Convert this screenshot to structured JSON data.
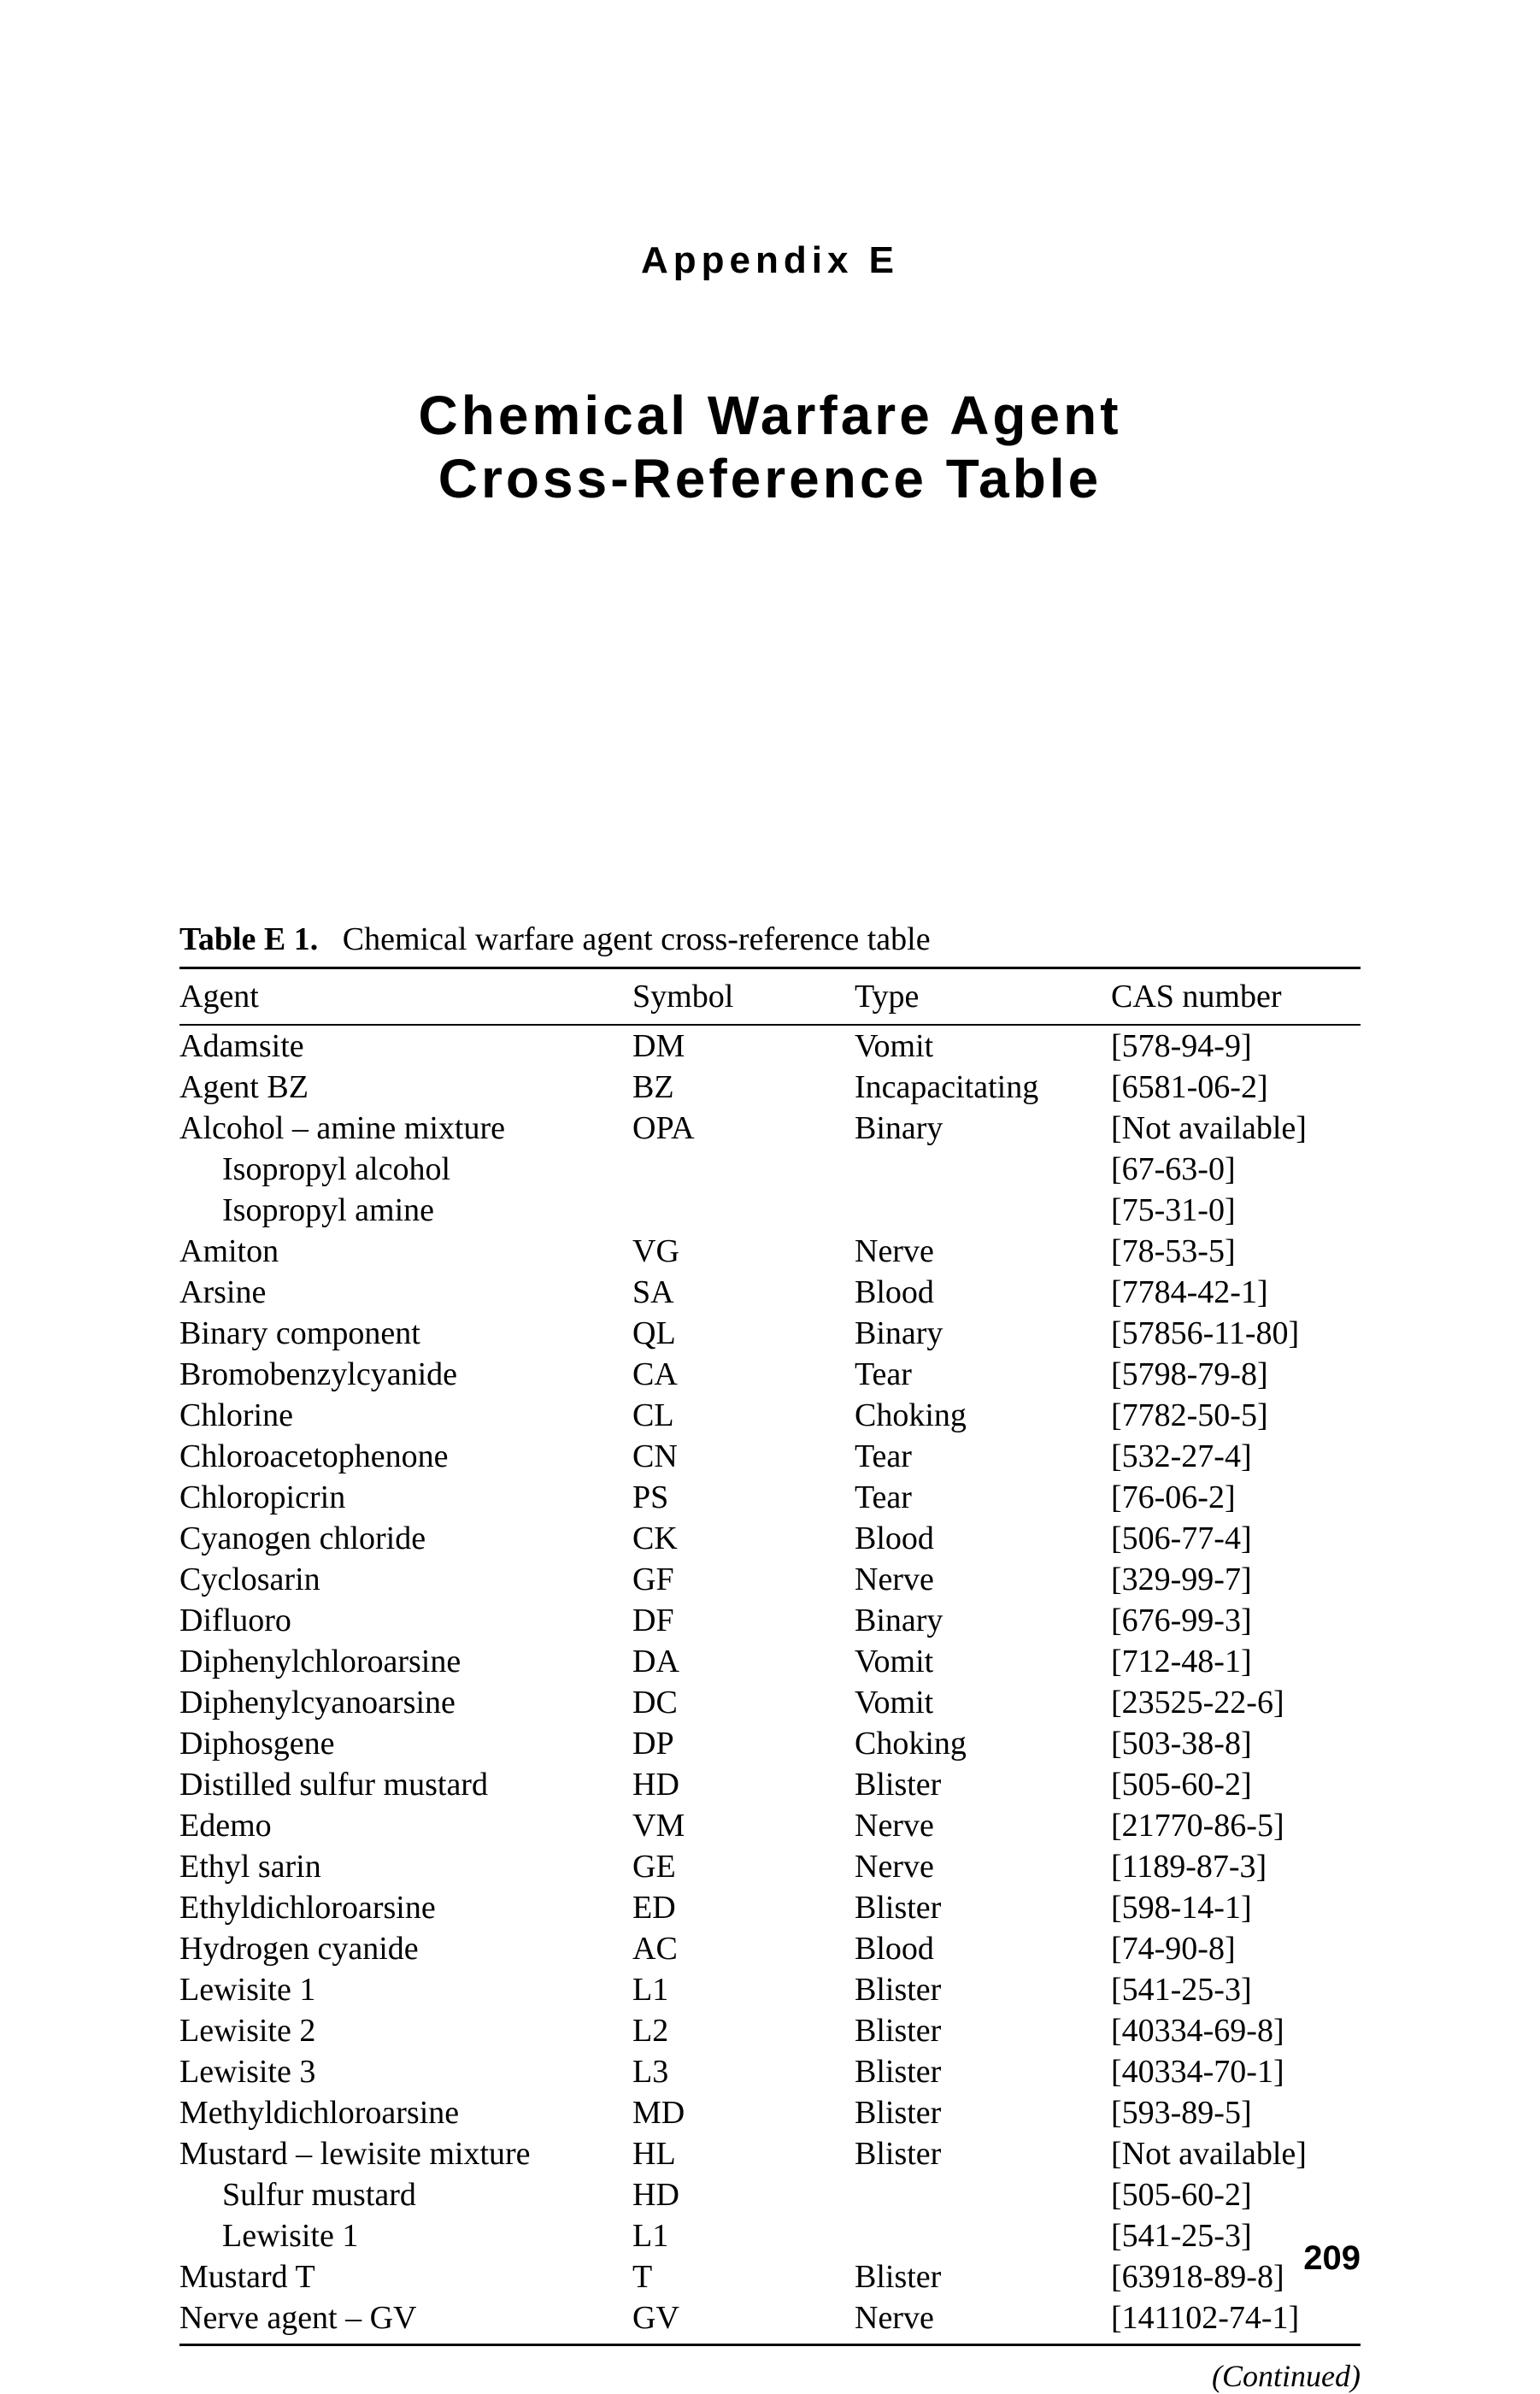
{
  "appendix_label": "Appendix E",
  "title_line1": "Chemical Warfare Agent",
  "title_line2": "Cross-Reference Table",
  "caption_bold": "Table E 1.",
  "caption_rest": "Chemical warfare agent cross-reference table",
  "headers": {
    "agent": "Agent",
    "symbol": "Symbol",
    "type": "Type",
    "cas": "CAS number"
  },
  "rows": [
    {
      "agent": "Adamsite",
      "symbol": "DM",
      "type": "Vomit",
      "cas": "[578-94-9]",
      "indent": false
    },
    {
      "agent": "Agent BZ",
      "symbol": "BZ",
      "type": "Incapacitating",
      "cas": "[6581-06-2]",
      "indent": false
    },
    {
      "agent": "Alcohol – amine mixture",
      "symbol": "OPA",
      "type": "Binary",
      "cas": "[Not available]",
      "indent": false
    },
    {
      "agent": "Isopropyl alcohol",
      "symbol": "",
      "type": "",
      "cas": "[67-63-0]",
      "indent": true
    },
    {
      "agent": "Isopropyl amine",
      "symbol": "",
      "type": "",
      "cas": "[75-31-0]",
      "indent": true
    },
    {
      "agent": "Amiton",
      "symbol": "VG",
      "type": "Nerve",
      "cas": "[78-53-5]",
      "indent": false
    },
    {
      "agent": "Arsine",
      "symbol": "SA",
      "type": "Blood",
      "cas": "[7784-42-1]",
      "indent": false
    },
    {
      "agent": "Binary component",
      "symbol": "QL",
      "type": "Binary",
      "cas": "[57856-11-80]",
      "indent": false
    },
    {
      "agent": "Bromobenzylcyanide",
      "symbol": "CA",
      "type": "Tear",
      "cas": "[5798-79-8]",
      "indent": false
    },
    {
      "agent": "Chlorine",
      "symbol": "CL",
      "type": "Choking",
      "cas": "[7782-50-5]",
      "indent": false
    },
    {
      "agent": "Chloroacetophenone",
      "symbol": "CN",
      "type": "Tear",
      "cas": "[532-27-4]",
      "indent": false
    },
    {
      "agent": "Chloropicrin",
      "symbol": "PS",
      "type": "Tear",
      "cas": "[76-06-2]",
      "indent": false
    },
    {
      "agent": "Cyanogen chloride",
      "symbol": "CK",
      "type": "Blood",
      "cas": "[506-77-4]",
      "indent": false
    },
    {
      "agent": "Cyclosarin",
      "symbol": "GF",
      "type": "Nerve",
      "cas": "[329-99-7]",
      "indent": false
    },
    {
      "agent": "Difluoro",
      "symbol": "DF",
      "type": "Binary",
      "cas": "[676-99-3]",
      "indent": false
    },
    {
      "agent": "Diphenylchloroarsine",
      "symbol": "DA",
      "type": "Vomit",
      "cas": "[712-48-1]",
      "indent": false
    },
    {
      "agent": "Diphenylcyanoarsine",
      "symbol": "DC",
      "type": "Vomit",
      "cas": "[23525-22-6]",
      "indent": false
    },
    {
      "agent": "Diphosgene",
      "symbol": "DP",
      "type": "Choking",
      "cas": "[503-38-8]",
      "indent": false
    },
    {
      "agent": "Distilled sulfur mustard",
      "symbol": "HD",
      "type": "Blister",
      "cas": "[505-60-2]",
      "indent": false
    },
    {
      "agent": "Edemo",
      "symbol": "VM",
      "type": "Nerve",
      "cas": "[21770-86-5]",
      "indent": false
    },
    {
      "agent": "Ethyl sarin",
      "symbol": "GE",
      "type": "Nerve",
      "cas": "[1189-87-3]",
      "indent": false
    },
    {
      "agent": "Ethyldichloroarsine",
      "symbol": "ED",
      "type": "Blister",
      "cas": "[598-14-1]",
      "indent": false
    },
    {
      "agent": "Hydrogen cyanide",
      "symbol": "AC",
      "type": "Blood",
      "cas": "[74-90-8]",
      "indent": false
    },
    {
      "agent": "Lewisite 1",
      "symbol": "L1",
      "type": "Blister",
      "cas": "[541-25-3]",
      "indent": false
    },
    {
      "agent": "Lewisite 2",
      "symbol": "L2",
      "type": "Blister",
      "cas": "[40334-69-8]",
      "indent": false
    },
    {
      "agent": "Lewisite 3",
      "symbol": "L3",
      "type": "Blister",
      "cas": "[40334-70-1]",
      "indent": false
    },
    {
      "agent": "Methyldichloroarsine",
      "symbol": "MD",
      "type": "Blister",
      "cas": "[593-89-5]",
      "indent": false
    },
    {
      "agent": "Mustard – lewisite mixture",
      "symbol": "HL",
      "type": "Blister",
      "cas": "[Not available]",
      "indent": false
    },
    {
      "agent": "Sulfur mustard",
      "symbol": "HD",
      "type": "",
      "cas": "[505-60-2]",
      "indent": true
    },
    {
      "agent": "Lewisite 1",
      "symbol": "L1",
      "type": "",
      "cas": "[541-25-3]",
      "indent": true
    },
    {
      "agent": "Mustard T",
      "symbol": "T",
      "type": "Blister",
      "cas": "[63918-89-8]",
      "indent": false
    },
    {
      "agent": "Nerve agent – GV",
      "symbol": "GV",
      "type": "Nerve",
      "cas": "[141102-74-1]",
      "indent": false
    }
  ],
  "continued_label": "(Continued)",
  "page_number": "209"
}
